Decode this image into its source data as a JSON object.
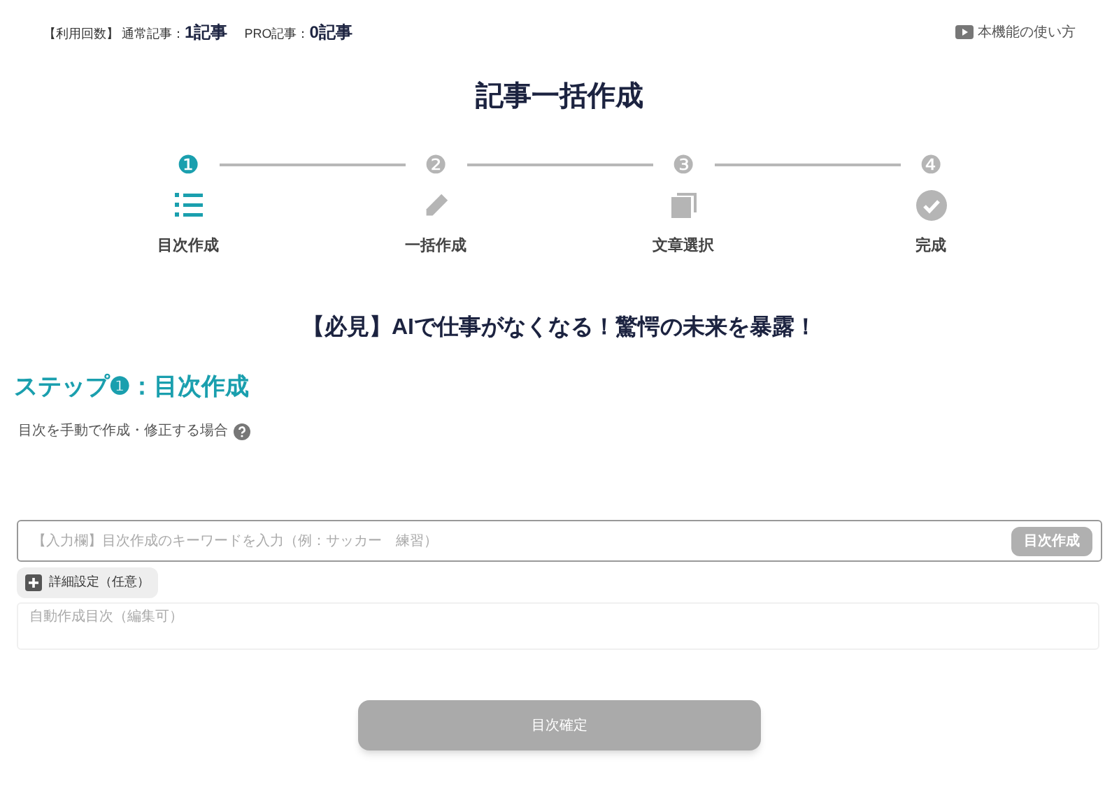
{
  "usage": {
    "label": "【利用回数】",
    "items": [
      {
        "label": "通常記事：",
        "value": "1記事"
      },
      {
        "label": "PRO記事：",
        "value": "0記事"
      }
    ]
  },
  "help_link": {
    "label": "本機能の使い方"
  },
  "title": "記事一括作成",
  "steps": [
    {
      "number": "❶",
      "label": "目次作成",
      "kind": "list",
      "selected": true
    },
    {
      "number": "❷",
      "label": "一括作成",
      "kind": "pencil",
      "selected": false
    },
    {
      "number": "❸",
      "label": "文章選択",
      "kind": "copy",
      "selected": false
    },
    {
      "number": "❹",
      "label": "完成",
      "kind": "check",
      "selected": false
    }
  ],
  "article_title": "【必見】AIで仕事がなくなる！驚愕の未来を暴露！",
  "section_heading": "ステップ❶：目次作成",
  "manual_note": "目次を手動で作成・修正する場合",
  "keyword_field": {
    "placeholder": "【入力欄】目次作成のキーワードを入力（例：サッカー　練習）",
    "button": "目次作成",
    "disabled": true
  },
  "details_button": "詳細設定（任意）",
  "outline_field": {
    "placeholder": "自動作成目次（編集可）"
  },
  "confirm_button": {
    "label": "目次確定",
    "disabled": true
  }
}
